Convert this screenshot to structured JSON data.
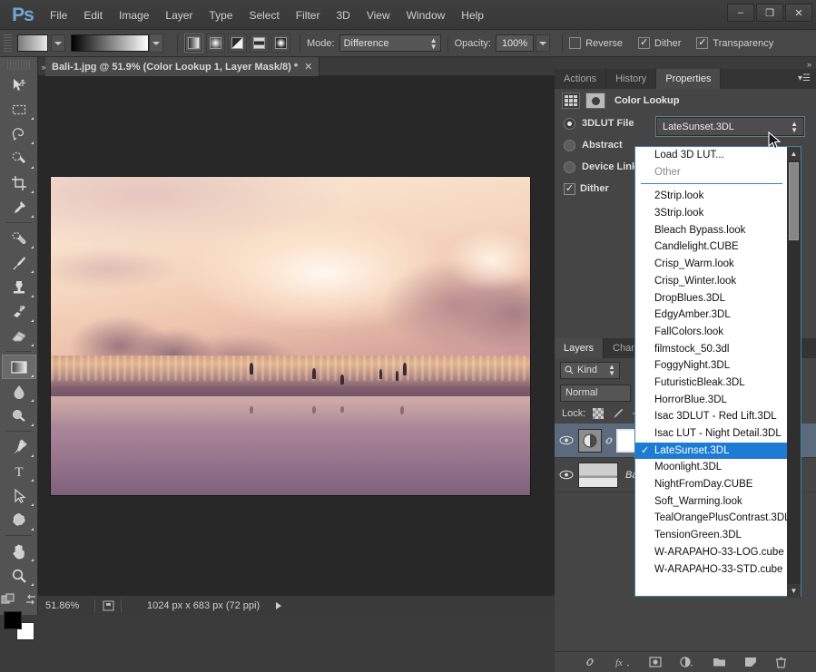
{
  "window": {
    "app_logo": "Ps",
    "minimize_label": "–",
    "maximize_label": "❐",
    "close_label": "✕"
  },
  "menubar": {
    "items": [
      "File",
      "Edit",
      "Image",
      "Layer",
      "Type",
      "Select",
      "Filter",
      "3D",
      "View",
      "Window",
      "Help"
    ]
  },
  "options_bar": {
    "mode_label": "Mode:",
    "mode_value": "Difference",
    "opacity_label": "Opacity:",
    "opacity_value": "100%",
    "reverse_label": "Reverse",
    "reverse_checked": false,
    "dither_label": "Dither",
    "dither_checked": true,
    "transparency_label": "Transparency",
    "transparency_checked": true,
    "gradient_types": [
      "linear-gradient",
      "radial-gradient",
      "angle-gradient",
      "reflected-gradient",
      "diamond-gradient"
    ],
    "gradient_type_selected": "linear-gradient"
  },
  "toolbar": {
    "tools": [
      {
        "name": "move-tool",
        "selected": false
      },
      {
        "name": "rectangular-marquee-tool",
        "selected": false
      },
      {
        "name": "lasso-tool",
        "selected": false
      },
      {
        "name": "quick-selection-tool",
        "selected": false
      },
      {
        "name": "crop-tool",
        "selected": false
      },
      {
        "name": "eyedropper-tool",
        "selected": false
      },
      {
        "name": "spot-healing-brush-tool",
        "selected": false
      },
      {
        "name": "brush-tool",
        "selected": false
      },
      {
        "name": "clone-stamp-tool",
        "selected": false
      },
      {
        "name": "history-brush-tool",
        "selected": false
      },
      {
        "name": "eraser-tool",
        "selected": false
      },
      {
        "name": "gradient-tool",
        "selected": true
      },
      {
        "name": "blur-tool",
        "selected": false
      },
      {
        "name": "dodge-tool",
        "selected": false
      },
      {
        "name": "pen-tool",
        "selected": false
      },
      {
        "name": "type-tool",
        "selected": false
      },
      {
        "name": "path-selection-tool",
        "selected": false
      },
      {
        "name": "custom-shape-tool",
        "selected": false
      },
      {
        "name": "hand-tool",
        "selected": false
      },
      {
        "name": "zoom-tool",
        "selected": false
      }
    ],
    "foreground_color": "#000000",
    "background_color": "#ffffff"
  },
  "document": {
    "tab_title": "Bali-1.jpg @ 51.9% (Color Lookup 1, Layer Mask/8) *",
    "close_glyph": "✕"
  },
  "status_bar": {
    "zoom": "51.86%",
    "doc_size": "1024 px x 683 px (72 ppi)"
  },
  "dock": {
    "top_tabs": [
      {
        "label": "Actions",
        "active": false
      },
      {
        "label": "History",
        "active": false
      },
      {
        "label": "Properties",
        "active": true
      }
    ],
    "panel_menu_glyph": "▾☰"
  },
  "properties": {
    "title": "Color Lookup",
    "radios": [
      {
        "label": "3DLUT File",
        "selected": true
      },
      {
        "label": "Abstract",
        "selected": false
      },
      {
        "label": "Device Link",
        "selected": false
      }
    ],
    "dither_label": "Dither",
    "dither_checked": true,
    "lut_value": "LateSunset.3DL"
  },
  "lut_dropdown": {
    "header_items": [
      {
        "label": "Load 3D LUT...",
        "muted": false
      },
      {
        "label": "Other",
        "muted": true
      }
    ],
    "items": [
      {
        "label": "2Strip.look",
        "selected": false
      },
      {
        "label": "3Strip.look",
        "selected": false
      },
      {
        "label": "Bleach Bypass.look",
        "selected": false
      },
      {
        "label": "Candlelight.CUBE",
        "selected": false
      },
      {
        "label": "Crisp_Warm.look",
        "selected": false
      },
      {
        "label": "Crisp_Winter.look",
        "selected": false
      },
      {
        "label": "DropBlues.3DL",
        "selected": false
      },
      {
        "label": "EdgyAmber.3DL",
        "selected": false
      },
      {
        "label": "FallColors.look",
        "selected": false
      },
      {
        "label": "filmstock_50.3dl",
        "selected": false
      },
      {
        "label": "FoggyNight.3DL",
        "selected": false
      },
      {
        "label": "FuturisticBleak.3DL",
        "selected": false
      },
      {
        "label": "HorrorBlue.3DL",
        "selected": false
      },
      {
        "label": "Isac 3DLUT - Red Lift.3DL",
        "selected": false
      },
      {
        "label": "Isac LUT - Night Detail.3DL",
        "selected": false
      },
      {
        "label": "LateSunset.3DL",
        "selected": true
      },
      {
        "label": "Moonlight.3DL",
        "selected": false
      },
      {
        "label": "NightFromDay.CUBE",
        "selected": false
      },
      {
        "label": "Soft_Warming.look",
        "selected": false
      },
      {
        "label": "TealOrangePlusContrast.3DL",
        "selected": false
      },
      {
        "label": "TensionGreen.3DL",
        "selected": false
      },
      {
        "label": "W-ARAPAHO-33-LOG.cube",
        "selected": false
      },
      {
        "label": "W-ARAPAHO-33-STD.cube",
        "selected": false
      }
    ],
    "check_glyph": "✓",
    "scroll_up_glyph": "▲",
    "scroll_down_glyph": "▼",
    "accent_color": "#1e7bd4"
  },
  "layers": {
    "tabs": [
      {
        "label": "Layers",
        "active": true
      },
      {
        "label": "Channel",
        "active": false
      }
    ],
    "filter_label": "Kind",
    "blend_mode": "Normal",
    "lock_label": "Lock:",
    "rows": [
      {
        "name": "",
        "type": "adjustment",
        "selected": true,
        "visible": true
      },
      {
        "name": "Ba",
        "type": "image",
        "selected": false,
        "visible": true
      }
    ],
    "footer_icons": [
      "link-icon",
      "fx-icon",
      "add-mask-icon",
      "new-adjustment-icon",
      "new-group-icon",
      "new-layer-icon",
      "delete-layer-icon"
    ]
  }
}
